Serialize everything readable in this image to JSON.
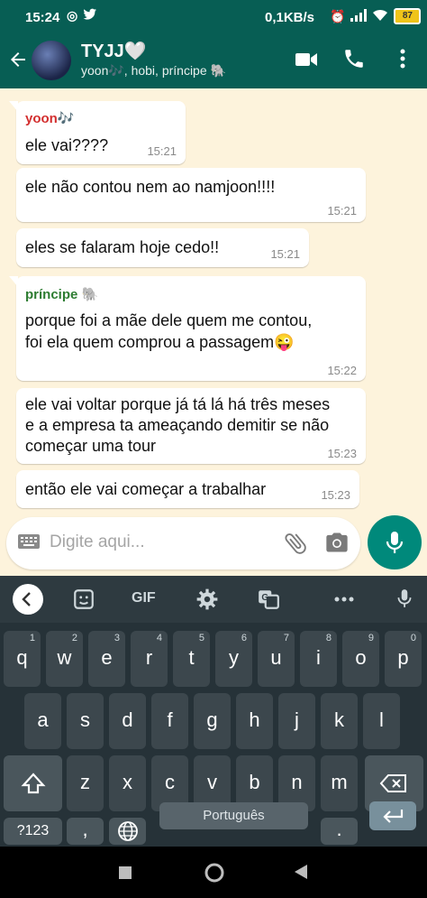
{
  "status_bar": {
    "time": "15:24",
    "speed": "0,1KB/s",
    "battery": "87"
  },
  "header": {
    "title": "TYJJ🤍",
    "subtitle": "yoon🎶, hobi, príncipe 🐘"
  },
  "messages": [
    {
      "sender": "yoon🎶",
      "text": "ele vai????",
      "time": "15:21"
    },
    {
      "text": "ele não contou nem ao namjoon!!!!",
      "time": "15:21"
    },
    {
      "text": "eles se falaram hoje cedo!!",
      "time": "15:21"
    },
    {
      "sender": "príncipe 🐘",
      "text": "porque foi a mãe dele quem me contou,\nfoi ela quem comprou a passagem😜",
      "time": "15:22"
    },
    {
      "text": "ele vai voltar porque já tá lá há três meses\ne a empresa ta ameaçando demitir se não\ncomeçar uma tour",
      "time": "15:23"
    },
    {
      "text": "então ele vai começar a trabalhar",
      "time": "15:23"
    }
  ],
  "input": {
    "placeholder": "Digite aqui..."
  },
  "keyboard": {
    "toolbar": {
      "gif": "GIF"
    },
    "row1": [
      {
        "k": "q",
        "h": "1"
      },
      {
        "k": "w",
        "h": "2"
      },
      {
        "k": "e",
        "h": "3"
      },
      {
        "k": "r",
        "h": "4"
      },
      {
        "k": "t",
        "h": "5"
      },
      {
        "k": "y",
        "h": "6"
      },
      {
        "k": "u",
        "h": "7"
      },
      {
        "k": "i",
        "h": "8"
      },
      {
        "k": "o",
        "h": "9"
      },
      {
        "k": "p",
        "h": "0"
      }
    ],
    "row2": [
      "a",
      "s",
      "d",
      "f",
      "g",
      "h",
      "j",
      "k",
      "l"
    ],
    "row3": [
      "z",
      "x",
      "c",
      "v",
      "b",
      "n",
      "m"
    ],
    "symbols": "?123",
    "comma": ",",
    "space": "Português",
    "period": "."
  },
  "colors": {
    "header": "#075e54",
    "chat_bg": "#fdf3dc",
    "accent": "#00897b",
    "yoon_name": "#d32f2f",
    "principe_name": "#2e7d32"
  }
}
